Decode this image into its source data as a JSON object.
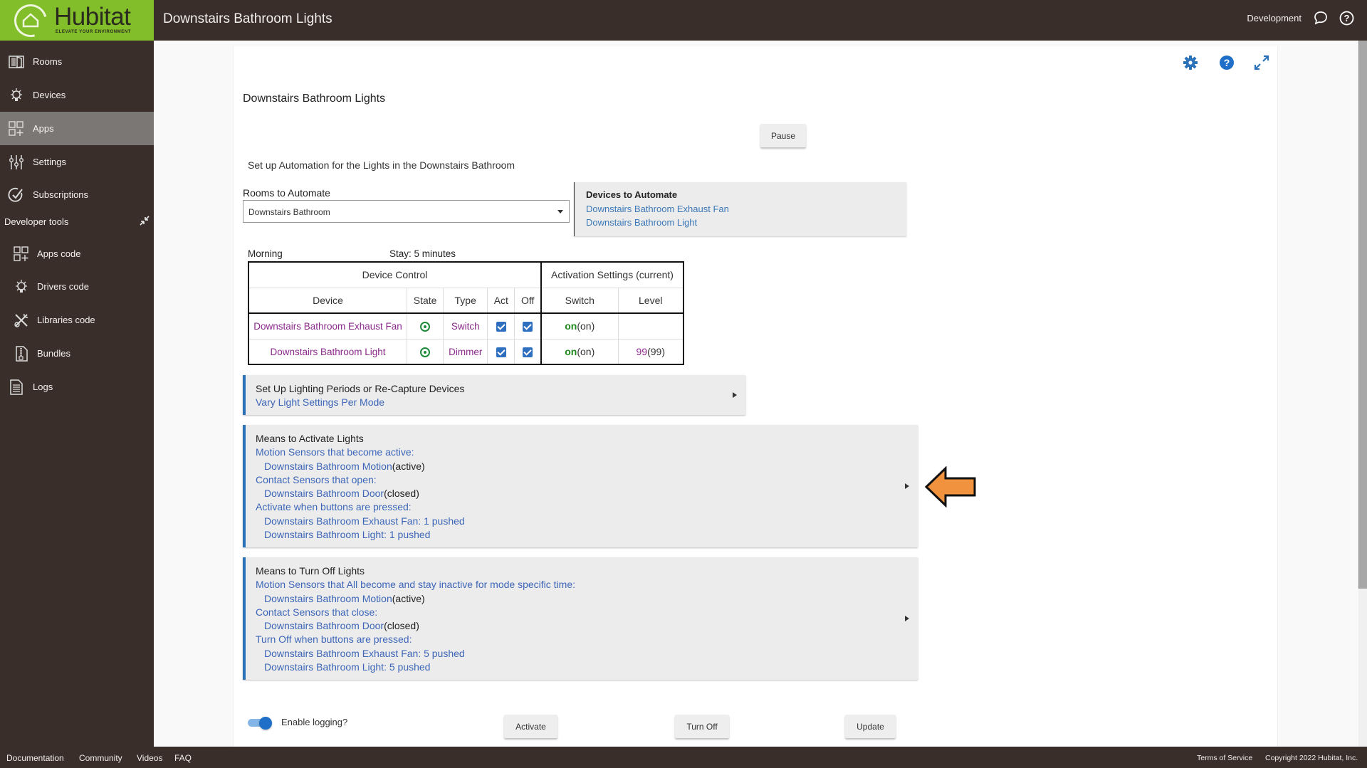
{
  "header": {
    "brand": "Hubitat",
    "brand_tagline": "ELEVATE YOUR ENVIRONMENT",
    "title": "Downstairs Bathroom Lights",
    "environment": "Development",
    "icons": [
      "chat-bubble-icon",
      "help-circle-icon"
    ]
  },
  "sidebar": {
    "items": [
      {
        "label": "Rooms",
        "icon": "rooms-icon"
      },
      {
        "label": "Devices",
        "icon": "lightbulb-icon"
      },
      {
        "label": "Apps",
        "icon": "apps-grid-icon",
        "active": true
      },
      {
        "label": "Settings",
        "icon": "sliders-icon"
      },
      {
        "label": "Subscriptions",
        "icon": "check-circle-icon"
      }
    ],
    "dev_tools_label": "Developer tools",
    "dev_items": [
      {
        "label": "Apps code",
        "icon": "apps-grid-icon"
      },
      {
        "label": "Drivers code",
        "icon": "lightbulb-icon"
      },
      {
        "label": "Libraries code",
        "icon": "tools-icon"
      },
      {
        "label": "Bundles",
        "icon": "zip-file-icon"
      },
      {
        "label": "Logs",
        "icon": "document-icon"
      }
    ]
  },
  "toolbar": {
    "icons": [
      "gear-icon",
      "help-icon",
      "fullscreen-icon"
    ]
  },
  "app": {
    "title": "Downstairs Bathroom Lights",
    "pause_label": "Pause",
    "subtitle": "Set up Automation for the Lights in the Downstairs Bathroom",
    "rooms_label": "Rooms to Automate",
    "rooms_value": "Downstairs Bathroom",
    "devices_title": "Devices to Automate",
    "devices": [
      "Downstairs Bathroom Exhaust Fan",
      "Downstairs Bathroom Light"
    ],
    "mode": "Morning",
    "stay": "Stay: 5 minutes"
  },
  "table": {
    "group_headers": [
      "Device Control",
      "Activation Settings (current)"
    ],
    "columns": [
      "Device",
      "State",
      "Type",
      "Act",
      "Off",
      "Switch",
      "Level"
    ],
    "rows": [
      {
        "device": "Downstairs Bathroom Exhaust Fan",
        "state": "on",
        "type": "Switch",
        "act": true,
        "off": true,
        "switch_set": "on",
        "switch_cur": "(on)",
        "level_set": "",
        "level_cur": ""
      },
      {
        "device": "Downstairs Bathroom Light",
        "state": "on",
        "type": "Dimmer",
        "act": true,
        "off": true,
        "switch_set": "on",
        "switch_cur": "(on)",
        "level_set": "99",
        "level_cur": "(99)"
      }
    ]
  },
  "sections": {
    "periods": {
      "title": "Set Up Lighting Periods or Re-Capture Devices",
      "subtitle": "Vary Light Settings Per Mode"
    },
    "activate": {
      "title": "Means to Activate Lights",
      "motion_label": "Motion Sensors that become active:",
      "motion_device": "Downstairs Bathroom Motion",
      "motion_state": "(active)",
      "contact_label": "Contact Sensors that open:",
      "contact_device": "Downstairs Bathroom Door",
      "contact_state": "(closed)",
      "buttons_label": "Activate when buttons are pressed:",
      "buttons": [
        "Downstairs Bathroom Exhaust Fan: 1 pushed",
        "Downstairs Bathroom Light: 1 pushed"
      ]
    },
    "turnoff": {
      "title": "Means to Turn Off Lights",
      "motion_label": "Motion Sensors that All become and stay inactive for mode specific time:",
      "motion_device": "Downstairs Bathroom Motion",
      "motion_state": "(active)",
      "contact_label": "Contact Sensors that close:",
      "contact_device": "Downstairs Bathroom Door",
      "contact_state": "(closed)",
      "buttons_label": "Turn Off when buttons are pressed:",
      "buttons": [
        "Downstairs Bathroom Exhaust Fan: 5 pushed",
        "Downstairs Bathroom Light: 5 pushed"
      ]
    }
  },
  "bottom": {
    "logging_label": "Enable logging?",
    "logging_enabled": true,
    "activate_label": "Activate",
    "turnoff_label": "Turn Off",
    "update_label": "Update"
  },
  "annotation": {
    "arrow_color": "#f0923e",
    "arrow_icon": "left-arrow-annotation-icon"
  },
  "footer": {
    "links": [
      "Documentation",
      "Community",
      "Videos",
      "FAQ"
    ],
    "terms": "Terms of Service",
    "copyright": "Copyright 2022 Hubitat, Inc."
  },
  "colors": {
    "brand_green": "#82bd2a",
    "header_bg": "#3a2e2a",
    "accent_blue": "#2b72b9",
    "link_blue": "#3d66b8",
    "device_purple": "#8a2a8a",
    "on_green": "#1d8a1d"
  }
}
